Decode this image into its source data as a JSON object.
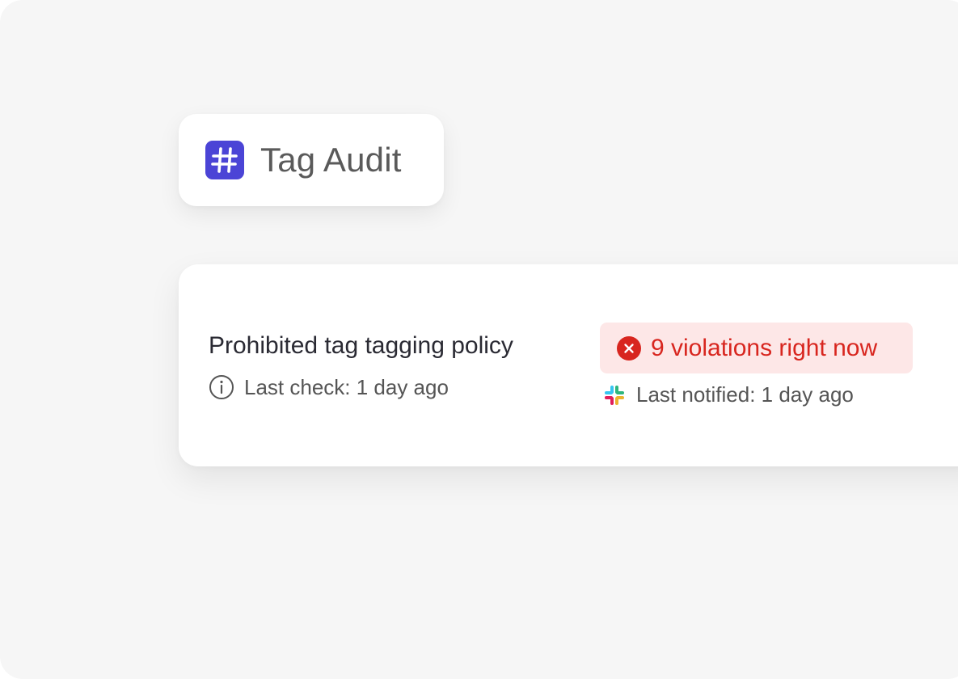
{
  "colors": {
    "background": "#f6f6f6",
    "card": "#ffffff",
    "hash_icon_bg": "#4b44d6",
    "error": "#d8261f",
    "error_badge_bg": "#fde7e7",
    "text_muted": "#555555"
  },
  "feature": {
    "icon": "hash-icon",
    "title": "Tag Audit"
  },
  "policy": {
    "name": "Prohibited tag tagging policy",
    "info_icon": "info-icon",
    "last_check": "Last check: 1 day ago",
    "violations": {
      "icon": "error-x-icon",
      "label": "9 violations right now"
    },
    "notification": {
      "icon": "slack-icon",
      "label": "Last notified: 1 day ago"
    }
  }
}
